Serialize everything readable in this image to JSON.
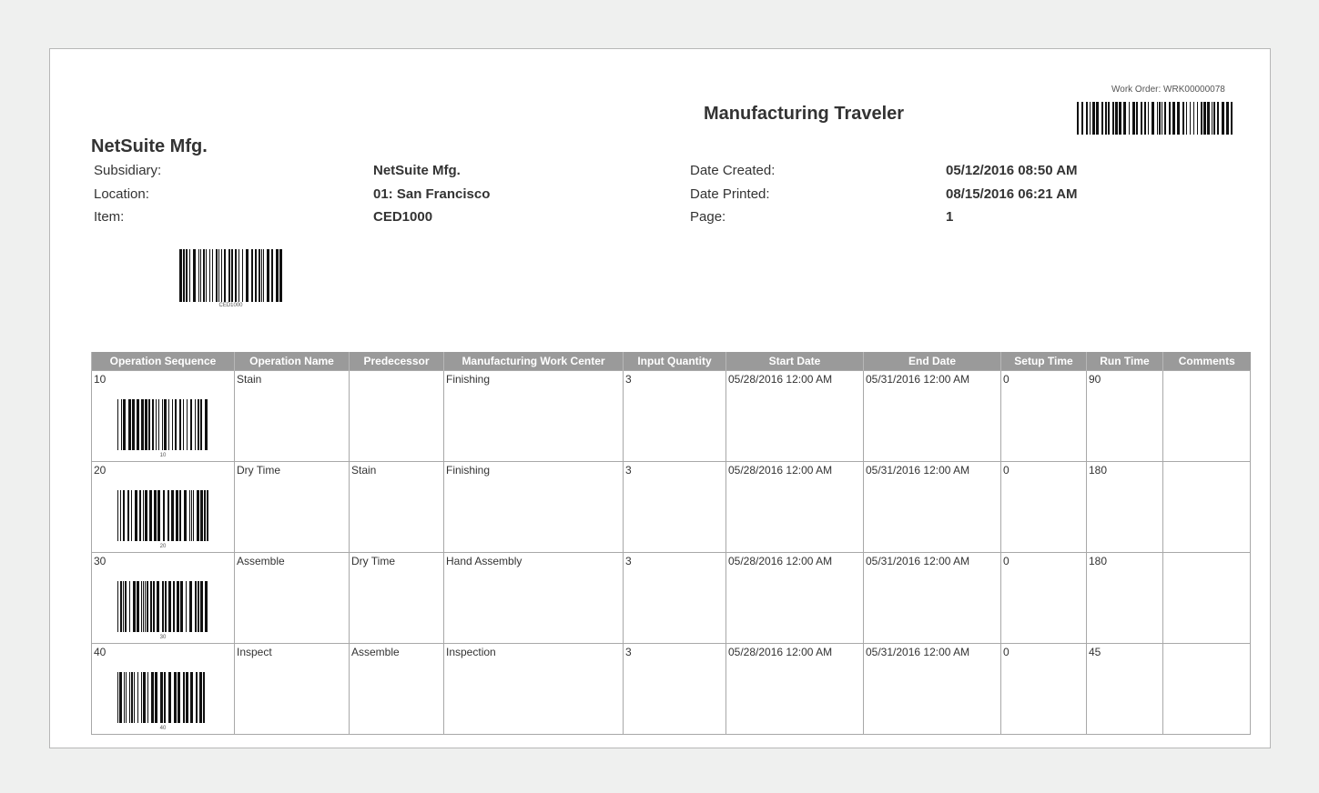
{
  "header": {
    "title": "Manufacturing Traveler",
    "work_order": "Work Order: WRK00000078",
    "company": "NetSuite Mfg."
  },
  "info": {
    "subsidiary_label": "Subsidiary:",
    "subsidiary_value": "NetSuite Mfg.",
    "location_label": "Location:",
    "location_value": "01: San Francisco",
    "item_label": "Item:",
    "item_value": "CED1000",
    "date_created_label": "Date Created:",
    "date_created_value": "05/12/2016 08:50 AM",
    "date_printed_label": "Date Printed:",
    "date_printed_value": "08/15/2016 06:21 AM",
    "page_label": "Page:",
    "page_value": "1"
  },
  "item_barcode_text": "CED1000",
  "table": {
    "headers": [
      "Operation Sequence",
      "Operation Name",
      "Predecessor",
      "Manufacturing Work Center",
      "Input Quantity",
      "Start Date",
      "End Date",
      "Setup Time",
      "Run Time",
      "Comments"
    ],
    "rows": [
      {
        "seq": "10",
        "name": "Stain",
        "predecessor": "",
        "work_center": "Finishing",
        "input_qty": "3",
        "start": "05/28/2016 12:00 AM",
        "end": "05/31/2016 12:00 AM",
        "setup": "0",
        "run": "90",
        "comments": "",
        "barcode_text": "10"
      },
      {
        "seq": "20",
        "name": "Dry Time",
        "predecessor": "Stain",
        "work_center": "Finishing",
        "input_qty": "3",
        "start": "05/28/2016 12:00 AM",
        "end": "05/31/2016 12:00 AM",
        "setup": "0",
        "run": "180",
        "comments": "",
        "barcode_text": "20"
      },
      {
        "seq": "30",
        "name": "Assemble",
        "predecessor": "Dry Time",
        "work_center": "Hand Assembly",
        "input_qty": "3",
        "start": "05/28/2016 12:00 AM",
        "end": "05/31/2016 12:00 AM",
        "setup": "0",
        "run": "180",
        "comments": "",
        "barcode_text": "30"
      },
      {
        "seq": "40",
        "name": "Inspect",
        "predecessor": "Assemble",
        "work_center": "Inspection",
        "input_qty": "3",
        "start": "05/28/2016 12:00 AM",
        "end": "05/31/2016 12:00 AM",
        "setup": "0",
        "run": "45",
        "comments": "",
        "barcode_text": "40"
      }
    ]
  },
  "colors": {
    "header_bg": "#9a9a9a",
    "page_bg": "#ffffff",
    "outer_bg": "#eff0ef"
  }
}
